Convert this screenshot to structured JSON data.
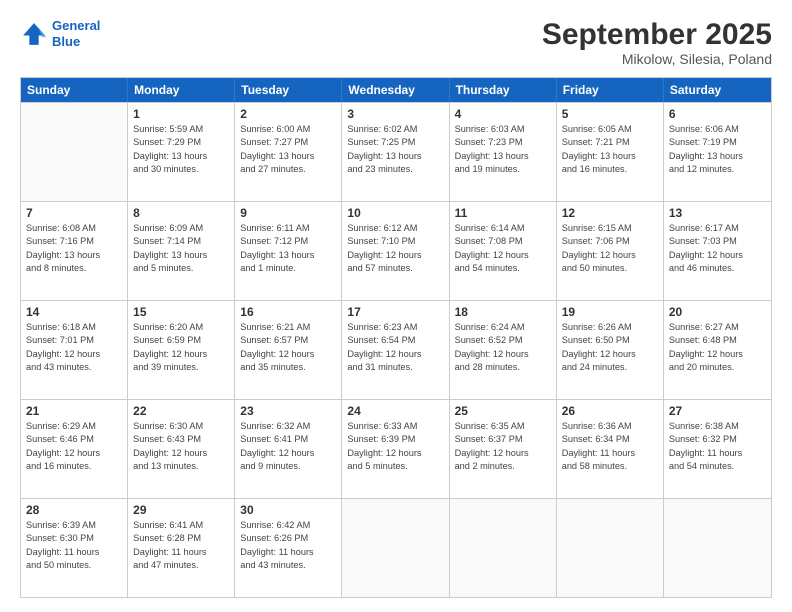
{
  "header": {
    "logo_line1": "General",
    "logo_line2": "Blue",
    "month": "September 2025",
    "location": "Mikolow, Silesia, Poland"
  },
  "days_of_week": [
    "Sunday",
    "Monday",
    "Tuesday",
    "Wednesday",
    "Thursday",
    "Friday",
    "Saturday"
  ],
  "weeks": [
    [
      {
        "day": "",
        "info": ""
      },
      {
        "day": "1",
        "info": "Sunrise: 5:59 AM\nSunset: 7:29 PM\nDaylight: 13 hours\nand 30 minutes."
      },
      {
        "day": "2",
        "info": "Sunrise: 6:00 AM\nSunset: 7:27 PM\nDaylight: 13 hours\nand 27 minutes."
      },
      {
        "day": "3",
        "info": "Sunrise: 6:02 AM\nSunset: 7:25 PM\nDaylight: 13 hours\nand 23 minutes."
      },
      {
        "day": "4",
        "info": "Sunrise: 6:03 AM\nSunset: 7:23 PM\nDaylight: 13 hours\nand 19 minutes."
      },
      {
        "day": "5",
        "info": "Sunrise: 6:05 AM\nSunset: 7:21 PM\nDaylight: 13 hours\nand 16 minutes."
      },
      {
        "day": "6",
        "info": "Sunrise: 6:06 AM\nSunset: 7:19 PM\nDaylight: 13 hours\nand 12 minutes."
      }
    ],
    [
      {
        "day": "7",
        "info": "Sunrise: 6:08 AM\nSunset: 7:16 PM\nDaylight: 13 hours\nand 8 minutes."
      },
      {
        "day": "8",
        "info": "Sunrise: 6:09 AM\nSunset: 7:14 PM\nDaylight: 13 hours\nand 5 minutes."
      },
      {
        "day": "9",
        "info": "Sunrise: 6:11 AM\nSunset: 7:12 PM\nDaylight: 13 hours\nand 1 minute."
      },
      {
        "day": "10",
        "info": "Sunrise: 6:12 AM\nSunset: 7:10 PM\nDaylight: 12 hours\nand 57 minutes."
      },
      {
        "day": "11",
        "info": "Sunrise: 6:14 AM\nSunset: 7:08 PM\nDaylight: 12 hours\nand 54 minutes."
      },
      {
        "day": "12",
        "info": "Sunrise: 6:15 AM\nSunset: 7:06 PM\nDaylight: 12 hours\nand 50 minutes."
      },
      {
        "day": "13",
        "info": "Sunrise: 6:17 AM\nSunset: 7:03 PM\nDaylight: 12 hours\nand 46 minutes."
      }
    ],
    [
      {
        "day": "14",
        "info": "Sunrise: 6:18 AM\nSunset: 7:01 PM\nDaylight: 12 hours\nand 43 minutes."
      },
      {
        "day": "15",
        "info": "Sunrise: 6:20 AM\nSunset: 6:59 PM\nDaylight: 12 hours\nand 39 minutes."
      },
      {
        "day": "16",
        "info": "Sunrise: 6:21 AM\nSunset: 6:57 PM\nDaylight: 12 hours\nand 35 minutes."
      },
      {
        "day": "17",
        "info": "Sunrise: 6:23 AM\nSunset: 6:54 PM\nDaylight: 12 hours\nand 31 minutes."
      },
      {
        "day": "18",
        "info": "Sunrise: 6:24 AM\nSunset: 6:52 PM\nDaylight: 12 hours\nand 28 minutes."
      },
      {
        "day": "19",
        "info": "Sunrise: 6:26 AM\nSunset: 6:50 PM\nDaylight: 12 hours\nand 24 minutes."
      },
      {
        "day": "20",
        "info": "Sunrise: 6:27 AM\nSunset: 6:48 PM\nDaylight: 12 hours\nand 20 minutes."
      }
    ],
    [
      {
        "day": "21",
        "info": "Sunrise: 6:29 AM\nSunset: 6:46 PM\nDaylight: 12 hours\nand 16 minutes."
      },
      {
        "day": "22",
        "info": "Sunrise: 6:30 AM\nSunset: 6:43 PM\nDaylight: 12 hours\nand 13 minutes."
      },
      {
        "day": "23",
        "info": "Sunrise: 6:32 AM\nSunset: 6:41 PM\nDaylight: 12 hours\nand 9 minutes."
      },
      {
        "day": "24",
        "info": "Sunrise: 6:33 AM\nSunset: 6:39 PM\nDaylight: 12 hours\nand 5 minutes."
      },
      {
        "day": "25",
        "info": "Sunrise: 6:35 AM\nSunset: 6:37 PM\nDaylight: 12 hours\nand 2 minutes."
      },
      {
        "day": "26",
        "info": "Sunrise: 6:36 AM\nSunset: 6:34 PM\nDaylight: 11 hours\nand 58 minutes."
      },
      {
        "day": "27",
        "info": "Sunrise: 6:38 AM\nSunset: 6:32 PM\nDaylight: 11 hours\nand 54 minutes."
      }
    ],
    [
      {
        "day": "28",
        "info": "Sunrise: 6:39 AM\nSunset: 6:30 PM\nDaylight: 11 hours\nand 50 minutes."
      },
      {
        "day": "29",
        "info": "Sunrise: 6:41 AM\nSunset: 6:28 PM\nDaylight: 11 hours\nand 47 minutes."
      },
      {
        "day": "30",
        "info": "Sunrise: 6:42 AM\nSunset: 6:26 PM\nDaylight: 11 hours\nand 43 minutes."
      },
      {
        "day": "",
        "info": ""
      },
      {
        "day": "",
        "info": ""
      },
      {
        "day": "",
        "info": ""
      },
      {
        "day": "",
        "info": ""
      }
    ]
  ]
}
